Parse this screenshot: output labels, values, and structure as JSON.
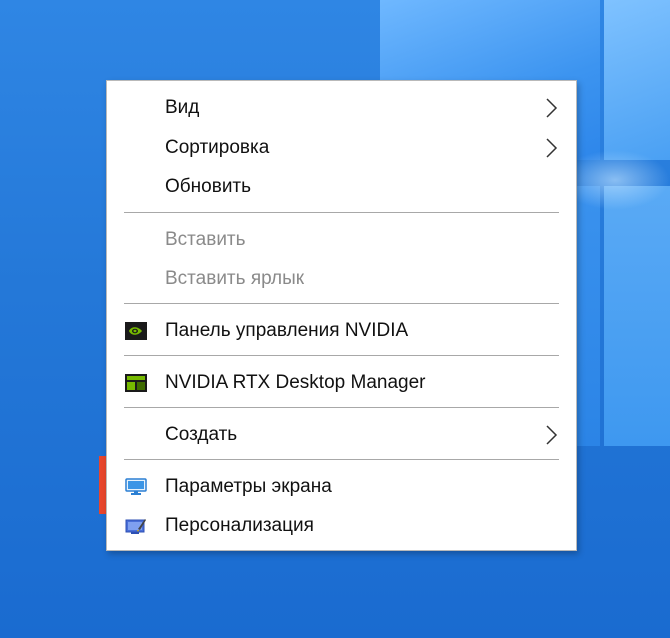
{
  "menu": {
    "items": [
      {
        "label": "Вид",
        "has_submenu": true,
        "enabled": true
      },
      {
        "label": "Сортировка",
        "has_submenu": true,
        "enabled": true
      },
      {
        "label": "Обновить",
        "has_submenu": false,
        "enabled": true
      },
      {
        "label": "Вставить",
        "has_submenu": false,
        "enabled": false
      },
      {
        "label": "Вставить ярлык",
        "has_submenu": false,
        "enabled": false
      },
      {
        "label": "Панель управления NVIDIA",
        "icon": "nvidia-icon",
        "has_submenu": false,
        "enabled": true
      },
      {
        "label": "NVIDIA RTX Desktop Manager",
        "icon": "nvidia-rtx-desktop-manager-icon",
        "has_submenu": false,
        "enabled": true
      },
      {
        "label": "Создать",
        "has_submenu": true,
        "enabled": true
      },
      {
        "label": "Параметры экрана",
        "icon": "display-icon",
        "has_submenu": false,
        "enabled": true,
        "highlighted": true
      },
      {
        "label": "Персонализация",
        "icon": "personalization-icon",
        "has_submenu": false,
        "enabled": true
      }
    ]
  },
  "colors": {
    "highlight_border": "#e8462c",
    "disabled_text": "#8a8a8a",
    "desktop_blue": "#2478d8"
  }
}
